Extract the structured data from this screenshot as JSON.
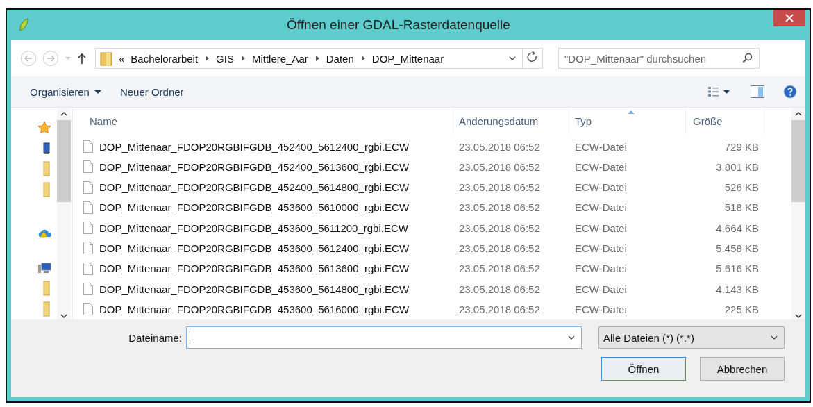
{
  "window": {
    "title": "Öffnen einer GDAL-Rasterdatenquelle"
  },
  "address_bar": {
    "overflow": "«",
    "path": [
      "Bachelorarbeit",
      "GIS",
      "Mittlere_Aar",
      "Daten",
      "DOP_Mittenaar"
    ]
  },
  "search": {
    "placeholder": "\"DOP_Mittenaar\" durchsuchen"
  },
  "toolbar": {
    "items": [
      "Organisieren",
      "Neuer Ordner"
    ]
  },
  "sidebar": {
    "items": [
      {
        "kind": "favorites"
      },
      {
        "kind": "desktop"
      },
      {
        "kind": "folder"
      },
      {
        "kind": "folder"
      },
      {
        "kind": "cloud"
      },
      {
        "kind": "computer"
      },
      {
        "kind": "folder"
      },
      {
        "kind": "folder"
      }
    ]
  },
  "table": {
    "columns": [
      {
        "label": "Name",
        "sorted": false
      },
      {
        "label": "Änderungsdatum",
        "sorted": false
      },
      {
        "label": "Typ",
        "sorted": true
      },
      {
        "label": "Größe",
        "sorted": false
      }
    ],
    "rows": [
      {
        "name": "DOP_Mittenaar_FDOP20RGBIFGDB_452400_5612400_rgbi.ECW",
        "date": "23.05.2018 06:52",
        "type": "ECW-Datei",
        "size": "729 KB"
      },
      {
        "name": "DOP_Mittenaar_FDOP20RGBIFGDB_452400_5613600_rgbi.ECW",
        "date": "23.05.2018 06:52",
        "type": "ECW-Datei",
        "size": "3.801 KB"
      },
      {
        "name": "DOP_Mittenaar_FDOP20RGBIFGDB_452400_5614800_rgbi.ECW",
        "date": "23.05.2018 06:52",
        "type": "ECW-Datei",
        "size": "526 KB"
      },
      {
        "name": "DOP_Mittenaar_FDOP20RGBIFGDB_453600_5610000_rgbi.ECW",
        "date": "23.05.2018 06:52",
        "type": "ECW-Datei",
        "size": "518 KB"
      },
      {
        "name": "DOP_Mittenaar_FDOP20RGBIFGDB_453600_5611200_rgbi.ECW",
        "date": "23.05.2018 06:52",
        "type": "ECW-Datei",
        "size": "4.664 KB"
      },
      {
        "name": "DOP_Mittenaar_FDOP20RGBIFGDB_453600_5612400_rgbi.ECW",
        "date": "23.05.2018 06:52",
        "type": "ECW-Datei",
        "size": "5.458 KB"
      },
      {
        "name": "DOP_Mittenaar_FDOP20RGBIFGDB_453600_5613600_rgbi.ECW",
        "date": "23.05.2018 06:52",
        "type": "ECW-Datei",
        "size": "5.616 KB"
      },
      {
        "name": "DOP_Mittenaar_FDOP20RGBIFGDB_453600_5614800_rgbi.ECW",
        "date": "23.05.2018 06:52",
        "type": "ECW-Datei",
        "size": "4.143 KB"
      },
      {
        "name": "DOP_Mittenaar_FDOP20RGBIFGDB_453600_5616000_rgbi.ECW",
        "date": "23.05.2018 06:52",
        "type": "ECW-Datei",
        "size": "225 KB"
      }
    ]
  },
  "filename": {
    "label": "Dateiname:"
  },
  "filetype": {
    "value": "Alle Dateien (*) (*.*)"
  },
  "buttons": [
    {
      "label": "Öffnen",
      "default": true
    },
    {
      "label": "Abbrechen",
      "default": false
    }
  ]
}
